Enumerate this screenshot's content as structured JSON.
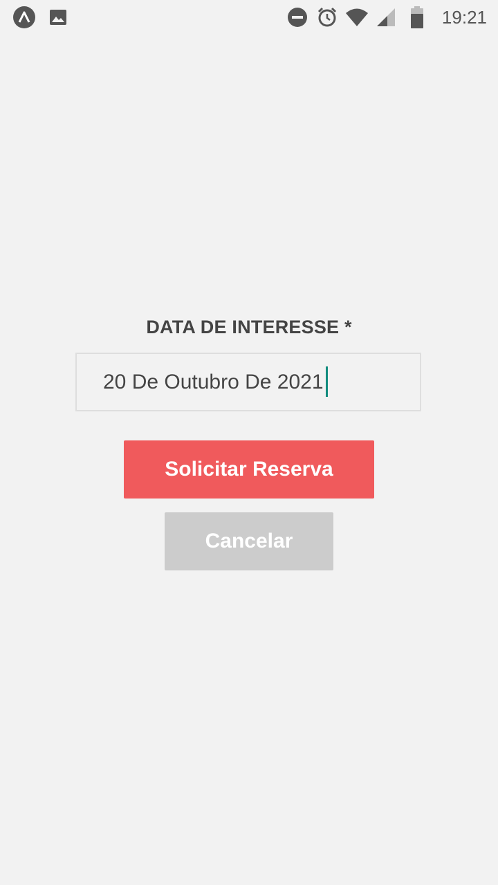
{
  "status_bar": {
    "time": "19:21",
    "icons": [
      "expo-app-icon",
      "image-notification-icon",
      "do-not-disturb-icon",
      "alarm-icon",
      "wifi-icon",
      "cell-signal-icon",
      "battery-icon"
    ]
  },
  "form": {
    "date_label": "DATA DE INTERESSE *",
    "date_value": "20 De Outubro De 2021"
  },
  "actions": {
    "request_label": "Solicitar Reserva",
    "cancel_label": "Cancelar"
  },
  "colors": {
    "background": "#f2f2f2",
    "primary_button": "#f05a5c",
    "secondary_button": "#cccccc",
    "caret": "#128c7e"
  }
}
